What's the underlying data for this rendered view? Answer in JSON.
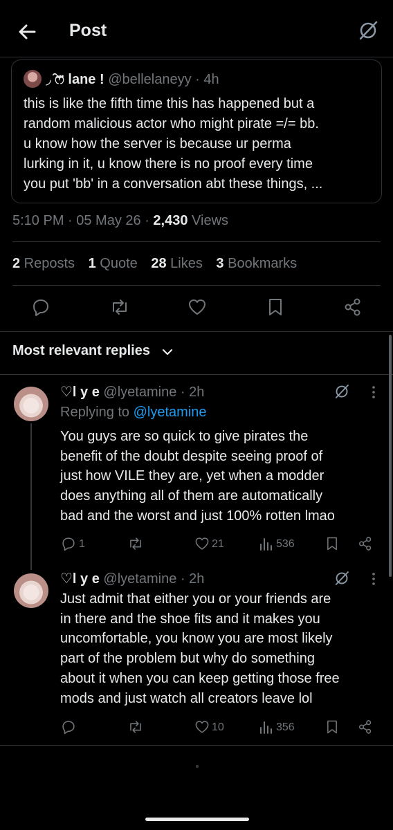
{
  "header": {
    "title": "Post"
  },
  "quote": {
    "display_name": "◞ ̑̑ෆ⃛ lane !",
    "handle": "@bellelaneyy",
    "sep": "·",
    "time": "4h",
    "text": "this is like the fifth time this has happened but a\nrandom malicious actor who might pirate =/= bb.\nu know how the server is because ur perma\nlurking in it, u know there is no proof every time\nyou put 'bb' in a conversation abt these things, ..."
  },
  "meta": {
    "time": "5:10 PM · 05 May 26 · ",
    "views_count": "2,430",
    "views_label": " Views"
  },
  "stats": {
    "reposts_count": "2",
    "reposts_label": " Reposts",
    "quotes_count": "1",
    "quotes_label": " Quote",
    "likes_count": "28",
    "likes_label": " Likes",
    "bookmarks_count": "3",
    "bookmarks_label": " Bookmarks"
  },
  "actions": [
    "reply-icon",
    "repost-icon",
    "like-icon",
    "bookmark-icon",
    "share-icon"
  ],
  "replies_header": "Most relevant replies",
  "replies": [
    {
      "display_name": "♡l y e",
      "handle": "@lyetamine",
      "time": "· 2h",
      "replying_label": "Replying to ",
      "replying_handle": "@lyetamine",
      "text": "You guys are so quick to give pirates the\nbenefit of the doubt despite seeing proof of\njust how VILE they are, yet when a modder\ndoes anything all of them are automatically\nbad and the worst and just 100% rotten lmao",
      "replies_count": "1",
      "likes_count": "21",
      "views_count": "536"
    },
    {
      "display_name": "♡l y e",
      "handle": "@lyetamine",
      "time": "· 2h",
      "text": "Just admit that either you or your friends are\nin there and the shoe fits and it makes you\nuncomfortable, you know you are most likely\npart of the problem but why do something\nabout it when you can keep getting those free\nmods and just watch all creators leave lol",
      "likes_count": "10",
      "views_count": "356"
    }
  ],
  "colors": {
    "background": "#000000",
    "text": "#e7e9ea",
    "muted": "#71767b",
    "link": "#1d9bf0",
    "border": "#2f3336"
  }
}
